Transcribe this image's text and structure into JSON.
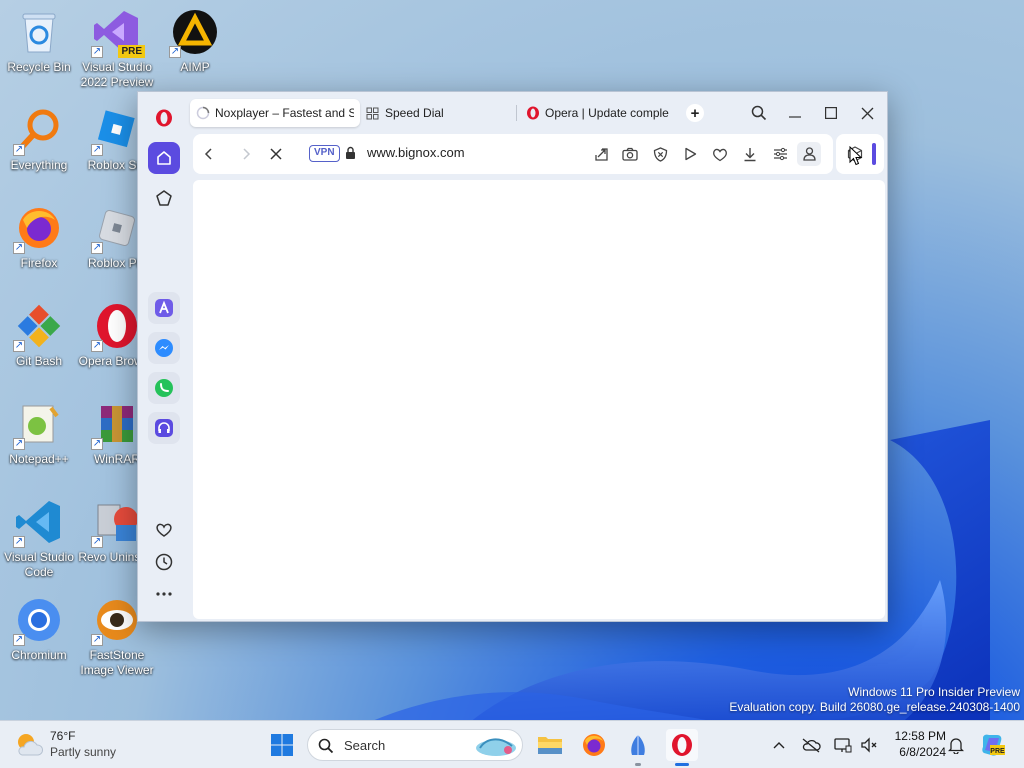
{
  "desktop": {
    "icons": [
      {
        "label": "Recycle Bin",
        "icon": "recycle-bin-icon"
      },
      {
        "label": "Visual Studio 2022 Preview",
        "icon": "visual-studio-preview-icon",
        "badge": "PRE"
      },
      {
        "label": "AIMP",
        "icon": "aimp-icon"
      },
      {
        "label": "Everything",
        "icon": "everything-icon"
      },
      {
        "label": "Roblox Stu",
        "icon": "roblox-studio-icon"
      },
      {
        "label": "Firefox",
        "icon": "firefox-icon"
      },
      {
        "label": "Roblox Pla",
        "icon": "roblox-player-icon"
      },
      {
        "label": "Git Bash",
        "icon": "git-bash-icon"
      },
      {
        "label": "Opera Browse",
        "icon": "opera-icon"
      },
      {
        "label": "Notepad++",
        "icon": "notepad-plus-plus-icon"
      },
      {
        "label": "WinRAR",
        "icon": "winrar-icon"
      },
      {
        "label": "Visual Studio Code",
        "icon": "vscode-icon"
      },
      {
        "label": "Revo Uninstall",
        "icon": "revo-uninstaller-icon"
      },
      {
        "label": "Chromium",
        "icon": "chromium-icon"
      },
      {
        "label": "FastStone Image Viewer",
        "icon": "faststone-icon"
      }
    ]
  },
  "browser": {
    "tabs": [
      {
        "label": "Noxplayer – Fastest and S",
        "state": "loading"
      },
      {
        "label": "Speed Dial"
      },
      {
        "label": "Opera | Update complet"
      }
    ],
    "new_tab_symbol": "+",
    "address": {
      "vpn_label": "VPN",
      "url": "www.bignox.com"
    },
    "colors": {
      "opera_red": "#e0152d",
      "accent": "#5b4be0"
    }
  },
  "watermark": {
    "line1": "Windows 11 Pro Insider Preview",
    "line2": "Evaluation copy. Build 26080.ge_release.240308-1400"
  },
  "taskbar": {
    "weather": {
      "temp": "76°F",
      "condition": "Partly sunny"
    },
    "search_placeholder": "Search",
    "clock": {
      "time": "12:58 PM",
      "date": "6/8/2024"
    }
  }
}
